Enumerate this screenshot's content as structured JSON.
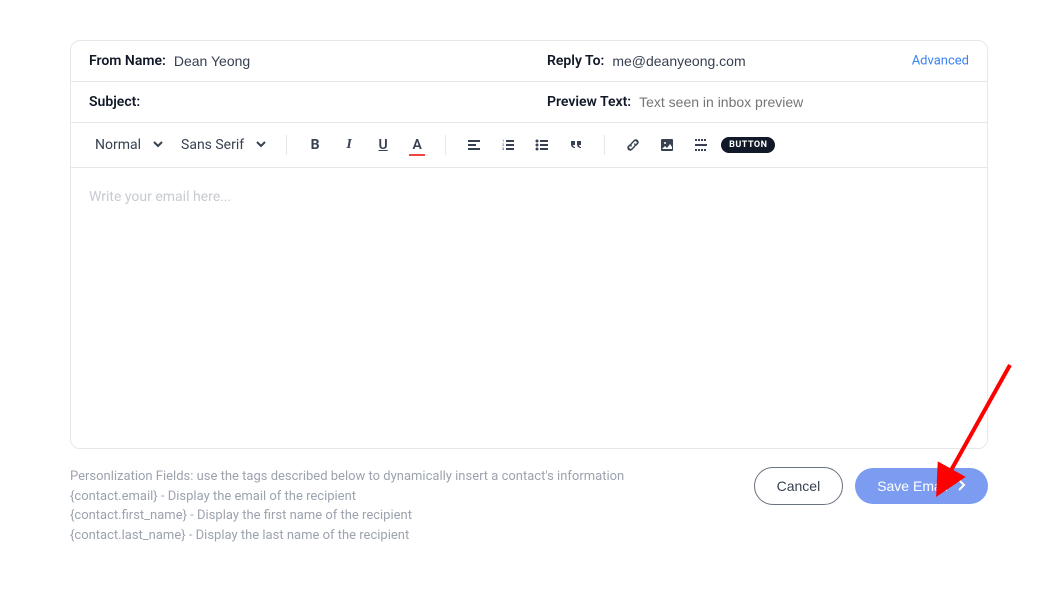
{
  "header": {
    "from_label": "From Name:",
    "from_value": "Dean Yeong",
    "reply_label": "Reply To:",
    "reply_value": "me@deanyeong.com",
    "advanced": "Advanced",
    "subject_label": "Subject:",
    "subject_value": "",
    "preview_label": "Preview Text:",
    "preview_placeholder": "Text seen in inbox preview"
  },
  "toolbar": {
    "format_select": "Normal",
    "font_select": "Sans Serif",
    "button_label": "BUTTON"
  },
  "editor": {
    "placeholder": "Write your email here..."
  },
  "footer": {
    "personalization_title": "Personlization Fields: use the tags described below to dynamically insert a contact's information",
    "field_email": "{contact.email} - Display the email of the recipient",
    "field_first": "{contact.first_name} - Display the first name of the recipient",
    "field_last": "{contact.last_name} - Display the last name of the recipient",
    "cancel": "Cancel",
    "save": "Save Email"
  }
}
